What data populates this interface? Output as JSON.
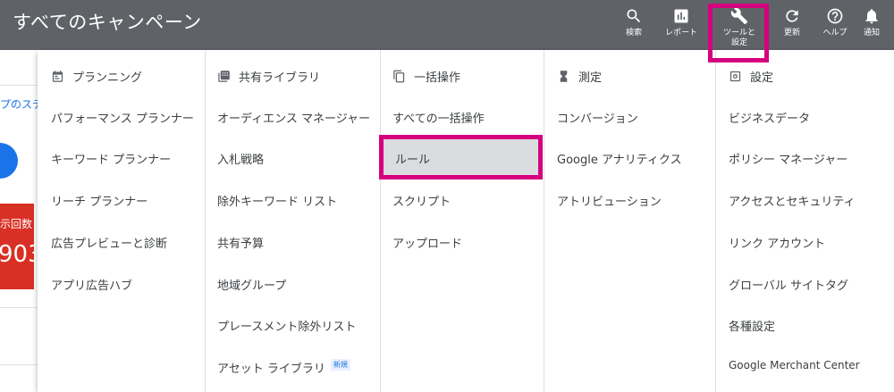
{
  "header": {
    "title": "すべてのキャンペーン"
  },
  "tools": [
    {
      "icon": "search-icon",
      "label": "検索"
    },
    {
      "icon": "report-icon",
      "label": "レポート"
    },
    {
      "icon": "wrench-icon",
      "label": "ツールと設定"
    },
    {
      "icon": "refresh-icon",
      "label": "更新"
    },
    {
      "icon": "help-icon",
      "label": "ヘルプ"
    },
    {
      "icon": "bell-icon",
      "label": "通知"
    }
  ],
  "background": {
    "link_text": "プのステ",
    "metric_label": "示回数 ▾",
    "metric_value": "903"
  },
  "menu": {
    "planning": {
      "heading": "プランニング",
      "items": [
        "パフォーマンス プランナー",
        "キーワード プランナー",
        "リーチ プランナー",
        "広告プレビューと診断",
        "アプリ広告ハブ"
      ]
    },
    "shared_library": {
      "heading": "共有ライブラリ",
      "items": [
        "オーディエンス マネージャー",
        "入札戦略",
        "除外キーワード リスト",
        "共有予算",
        "地域グループ",
        "プレースメント除外リスト",
        "アセット ライブラリ"
      ],
      "badge": "新規"
    },
    "bulk_actions": {
      "heading": "一括操作",
      "items": [
        "すべての一括操作",
        "ルール",
        "スクリプト",
        "アップロード"
      ]
    },
    "measurement": {
      "heading": "測定",
      "items": [
        "コンバージョン",
        "Google アナリティクス",
        "アトリビューション"
      ]
    },
    "setup": {
      "heading": "設定",
      "items": [
        "ビジネスデータ",
        "ポリシー マネージャー",
        "アクセスとセキュリティ",
        "リンク アカウント",
        "グローバル サイトタグ",
        "各種設定",
        "Google Merchant Center"
      ]
    }
  },
  "colors": {
    "topbar": "#5f6368",
    "highlight": "#d6007f",
    "selected_bg": "#dadce0",
    "link": "#1a73e8",
    "metric_bg": "#d93025"
  }
}
